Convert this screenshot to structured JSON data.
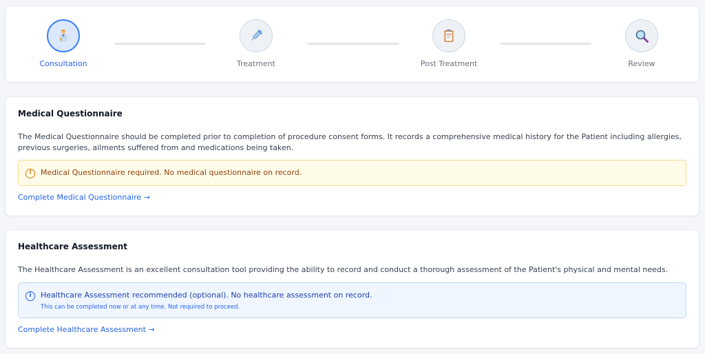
{
  "stepper": {
    "steps": [
      {
        "label": "Consultation",
        "icon": "doctor-icon",
        "active": true
      },
      {
        "label": "Treatment",
        "icon": "syringe-icon",
        "active": false
      },
      {
        "label": "Post Treatment",
        "icon": "clipboard-icon",
        "active": false
      },
      {
        "label": "Review",
        "icon": "magnifier-icon",
        "active": false
      }
    ]
  },
  "questionnaire": {
    "title": "Medical Questionnaire",
    "description": "The Medical Questionnaire should be completed prior to completion of procedure consent forms. It records a comprehensive medical history for the Patient including allergies, previous surgeries, ailments suffered from and medications being taken.",
    "alert_icon": "!",
    "alert_text": "Medical Questionnaire required. No medical questionnaire on record.",
    "link": "Complete Medical Questionnaire →"
  },
  "assessment": {
    "title": "Healthcare Assessment",
    "description": "The Healthcare Assessment is an excellent consultation tool providing the ability to record and conduct a thorough assessment of the Patient's physical and mental needs.",
    "alert_icon": "i",
    "alert_text": "Healthcare Assessment recommended (optional). No healthcare assessment on record.",
    "alert_subtext": "This can be completed now or at any time. Not required to proceed.",
    "link": "Complete Healthcare Assessment →"
  },
  "colors": {
    "accent": "#2563eb",
    "warning_bg": "#fefce8",
    "info_bg": "#eff6ff"
  }
}
